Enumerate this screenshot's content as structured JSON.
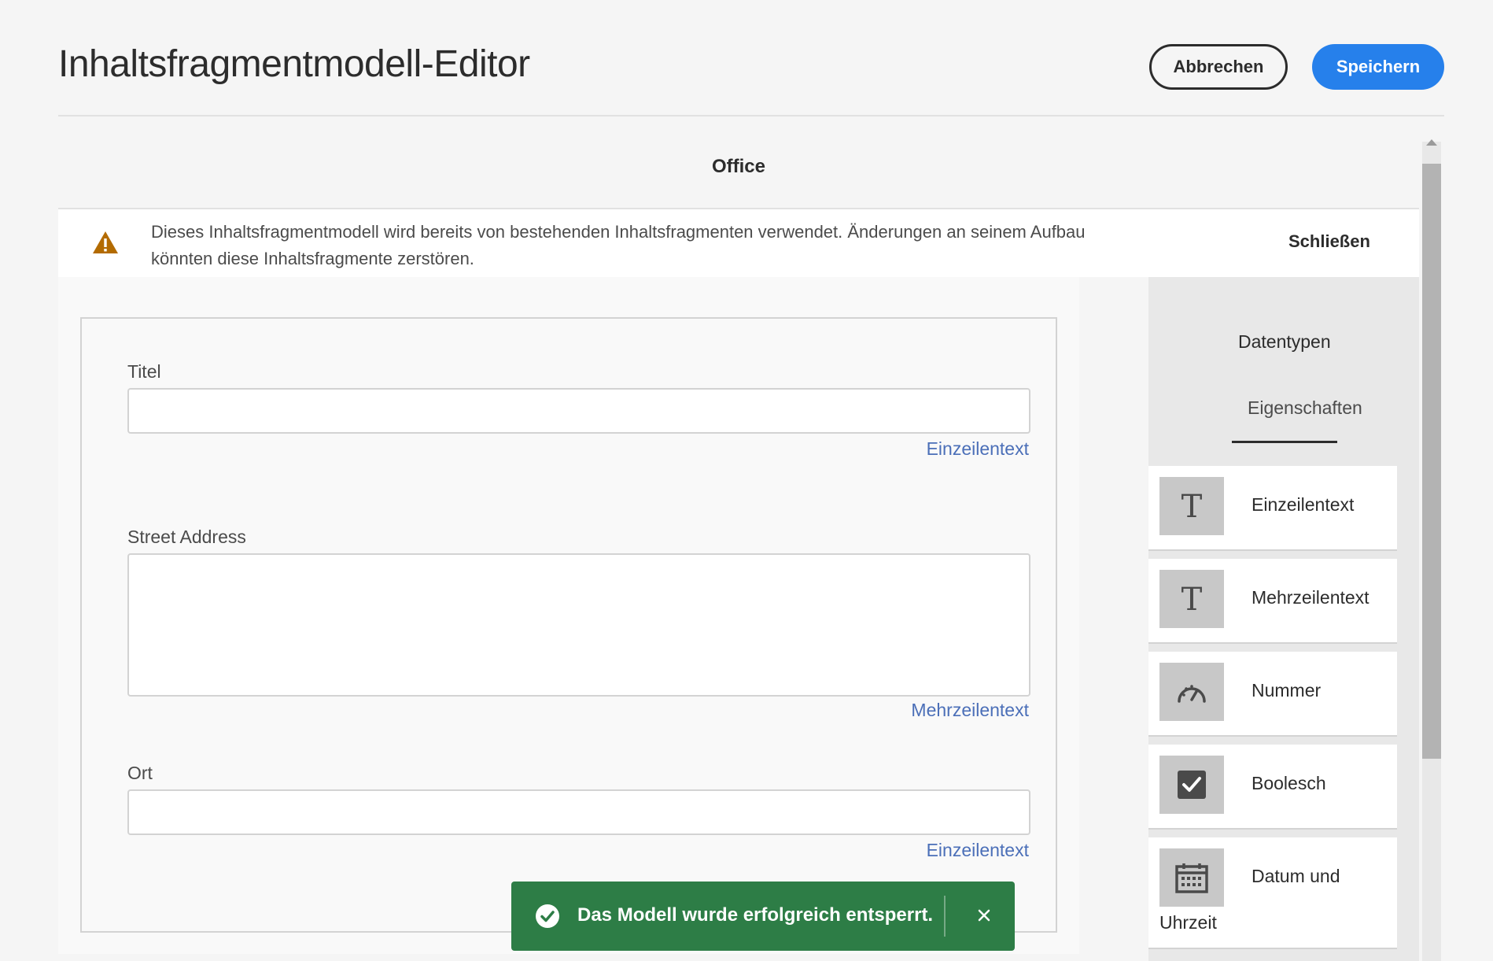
{
  "header": {
    "title": "Inhaltsfragmentmodell-Editor",
    "cancel_label": "Abbrechen",
    "save_label": "Speichern"
  },
  "model": {
    "name": "Office"
  },
  "alert": {
    "icon": "warning-icon",
    "message_line1": "Dieses Inhaltsfragmentmodell wird bereits von bestehenden Inhaltsfragmenten verwendet. Änderungen an seinem Aufbau",
    "message_line2": "könnten diese Inhaltsfragmente zerstören.",
    "close_label": "Schließen"
  },
  "fields": [
    {
      "label": "Titel",
      "type": "Einzeilentext"
    },
    {
      "label": "Street Address",
      "type": "Mehrzeilentext"
    },
    {
      "label": "Ort",
      "type": "Einzeilentext"
    }
  ],
  "side_panel": {
    "tabs": [
      {
        "label": "Datentypen"
      },
      {
        "label": "Eigenschaften",
        "active": true
      }
    ],
    "data_types": [
      {
        "label": "Einzeilentext",
        "icon": "text-icon"
      },
      {
        "label": "Mehrzeilentext",
        "icon": "text-icon"
      },
      {
        "label": "Nummer",
        "icon": "gauge-icon"
      },
      {
        "label": "Boolesch",
        "icon": "checkbox-icon"
      },
      {
        "label_line1": "Datum und",
        "label_line2": "Uhrzeit",
        "icon": "calendar-icon"
      }
    ]
  },
  "toast": {
    "message": "Das Modell wurde erfolgreich entsperrt.",
    "icon": "checkmark-circle-icon",
    "close_icon": "close-icon",
    "color": "#2d7d46"
  },
  "colors": {
    "accent": "#2680eb",
    "warning": "#b36b00",
    "link": "#4b6fb8"
  }
}
